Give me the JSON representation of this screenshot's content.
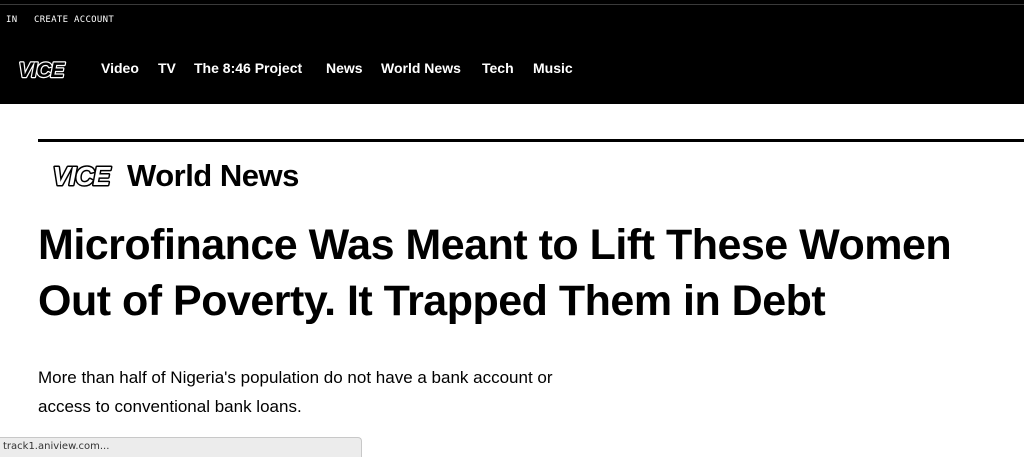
{
  "topbar": {
    "signin_label": "IN",
    "create_account_label": "CREATE ACCOUNT"
  },
  "nav": {
    "logo_text": "VICE",
    "items": [
      "Video",
      "TV",
      "The 8:46 Project",
      "News",
      "World News",
      "Tech",
      "Music"
    ]
  },
  "section": {
    "logo_text": "VICE",
    "label": "World News"
  },
  "article": {
    "headline_line1": "Microfinance Was Meant to Lift These Women",
    "headline_line2": "Out of Poverty. It Trapped Them in Debt",
    "dek": "More than half of Nigeria's population do not have a bank account or access to conventional bank loans."
  },
  "status_bar": {
    "url": "track1.aniview.com..."
  },
  "colors": {
    "nav_bg": "#000000",
    "page_bg": "#ffffff",
    "text": "#000000"
  }
}
